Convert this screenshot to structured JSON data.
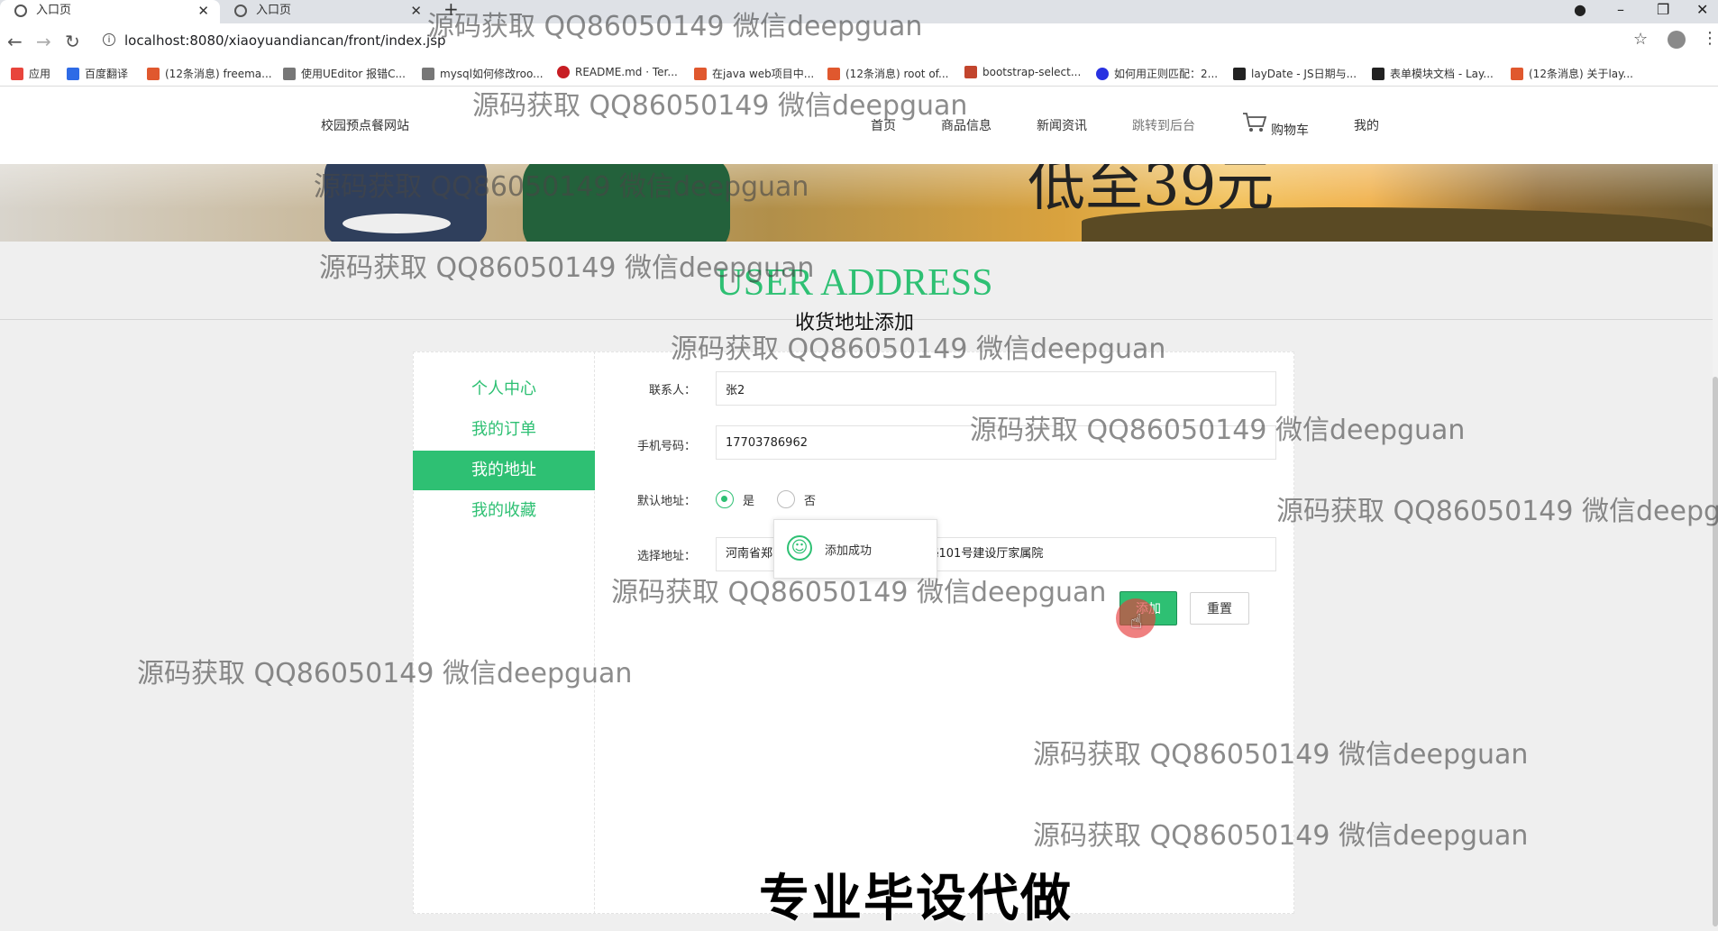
{
  "browser": {
    "tabs": [
      {
        "title": "入口页",
        "close": "✕"
      },
      {
        "title": "入口页",
        "close": "✕"
      }
    ],
    "new_tab": "+",
    "window_controls": {
      "minimize": "–",
      "restore": "❐",
      "close": "✕"
    },
    "url": "localhost:8080/xiaoyuandiancan/front/index.jsp",
    "bookmarks": [
      {
        "label": "应用",
        "icon": "apps-grid-icon",
        "color": "#e8453c"
      },
      {
        "label": "百度翻译",
        "icon": "baidu-translate-icon",
        "color": "#2e6be6"
      },
      {
        "label": "(12条消息) freema...",
        "icon": "csdn-icon",
        "color": "#e0582e"
      },
      {
        "label": "使用UEditor 报错C...",
        "icon": "ueditor-icon",
        "color": "#555555"
      },
      {
        "label": "mysql如何修改roo...",
        "icon": "mysql-icon",
        "color": "#555555"
      },
      {
        "label": "README.md · Ter...",
        "icon": "gitee-icon",
        "color": "#c71d23"
      },
      {
        "label": "在java web项目中...",
        "icon": "csdn-icon",
        "color": "#e0582e"
      },
      {
        "label": "(12条消息) root of...",
        "icon": "csdn-icon",
        "color": "#e0582e"
      },
      {
        "label": "bootstrap-select...",
        "icon": "cnblogs-icon",
        "color": "#c2452d"
      },
      {
        "label": "如何用正则匹配：2...",
        "icon": "baidu-icon",
        "color": "#2932e1"
      },
      {
        "label": "layDate - JS日期与...",
        "icon": "layui-icon",
        "color": "#222222"
      },
      {
        "label": "表单模块文档 - Lay...",
        "icon": "layui-icon",
        "color": "#222222"
      },
      {
        "label": "(12条消息) 关于lay...",
        "icon": "csdn-icon",
        "color": "#e0582e"
      }
    ]
  },
  "site": {
    "name": "校园预点餐网站",
    "nav": [
      "首页",
      "商品信息",
      "新闻资讯",
      "跳转到后台",
      "购物车",
      "我的"
    ],
    "banner_text": "低至39元"
  },
  "section": {
    "title": "USER ADDRESS",
    "subtitle": "收货地址添加"
  },
  "side_menu": [
    {
      "label": "个人中心",
      "active": false
    },
    {
      "label": "我的订单",
      "active": false
    },
    {
      "label": "我的地址",
      "active": true
    },
    {
      "label": "我的收藏",
      "active": false
    }
  ],
  "form": {
    "contact_label": "联系人：",
    "contact_value": "张2",
    "phone_label": "手机号码：",
    "phone_value": "17703786962",
    "default_label": "默认地址：",
    "default_options": [
      "是",
      "否"
    ],
    "default_selected": "是",
    "address_label": "选择地址：",
    "address_value_left": "河南省郑",
    "address_value_right": "§101号建设厅家属院",
    "add_button": "添加",
    "reset_button": "重置"
  },
  "toast": {
    "text": "添加成功",
    "icon": "smile-icon"
  },
  "watermark": "源码获取 QQ86050149 微信deepguan",
  "caption": "专业毕设代做",
  "colors": {
    "accent": "#2ec073",
    "click_marker": "#e63c3c"
  }
}
